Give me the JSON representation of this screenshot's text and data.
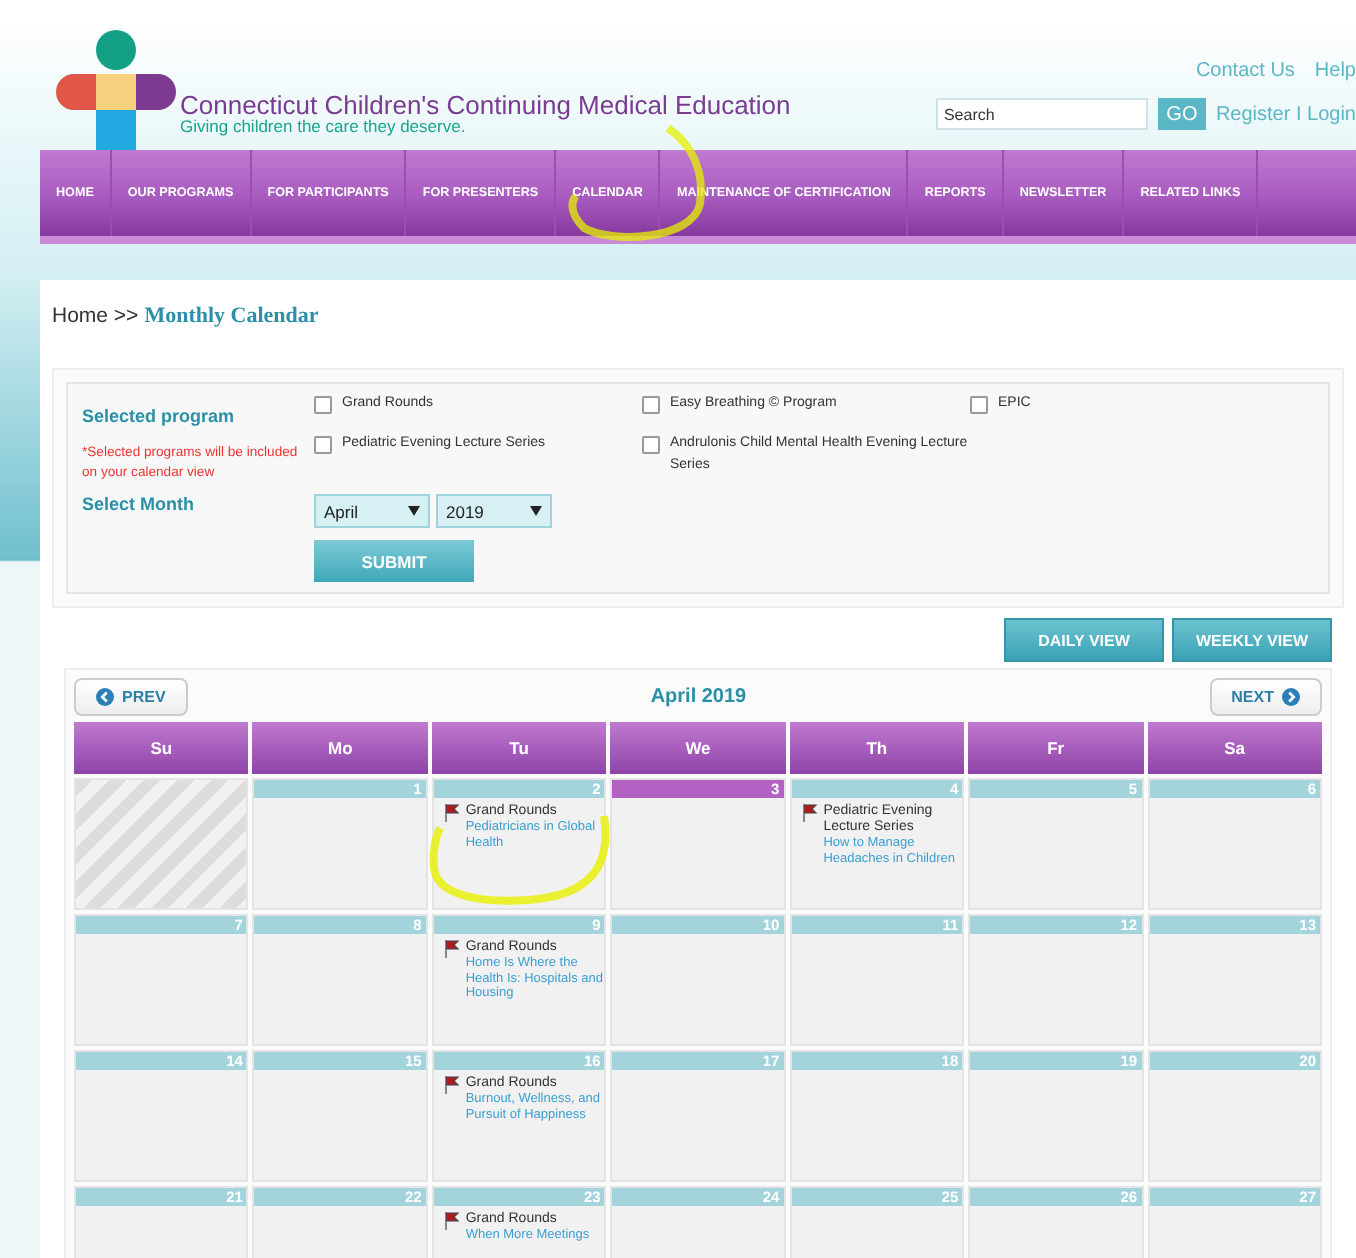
{
  "header": {
    "title": "Connecticut Children's Continuing Medical Education",
    "tagline": "Giving children the care they deserve.",
    "top_links": [
      "Contact Us",
      "Help"
    ],
    "search": {
      "placeholder": "Search",
      "button": "GO"
    },
    "account_links": "Register I Login"
  },
  "nav": [
    "HOME",
    "OUR PROGRAMS",
    "FOR PARTICIPANTS",
    "FOR PRESENTERS",
    "CALENDAR",
    "MAINTENANCE OF CERTIFICATION",
    "REPORTS",
    "NEWSLETTER",
    "RELATED LINKS"
  ],
  "breadcrumb": {
    "home": "Home >>",
    "current": "Monthly Calendar"
  },
  "filter": {
    "program_label": "Selected program",
    "note": "*Selected programs will be included on your calendar view",
    "programs": [
      {
        "label": "Grand Rounds",
        "checked": false
      },
      {
        "label": "Easy Breathing © Program",
        "checked": false
      },
      {
        "label": "EPIC",
        "checked": false
      },
      {
        "label": "Pediatric Evening Lecture Series",
        "checked": false
      },
      {
        "label": "Andrulonis Child Mental Health Evening Lecture Series",
        "checked": false
      }
    ],
    "month_label": "Select Month",
    "month": "April",
    "year": "2019",
    "submit": "SUBMIT"
  },
  "views": [
    "DAILY VIEW",
    "WEEKLY VIEW"
  ],
  "calendar": {
    "prev": "PREV",
    "title": "April 2019",
    "next": "NEXT",
    "days": [
      "Su",
      "Mo",
      "Tu",
      "We",
      "Th",
      "Fr",
      "Sa"
    ],
    "weeks": [
      [
        {
          "kind": "blank"
        },
        {
          "kind": "day",
          "date": "1",
          "today": false
        },
        {
          "kind": "day",
          "date": "2",
          "today": false,
          "events": [
            {
              "program": "Grand Rounds",
              "title": "Pediatricians in Global Health"
            }
          ]
        },
        {
          "kind": "day",
          "date": "3",
          "today": true
        },
        {
          "kind": "day",
          "date": "4",
          "today": false,
          "events": [
            {
              "program": "Pediatric Evening Lecture Series",
              "title": "How to Manage Headaches in Children"
            }
          ]
        },
        {
          "kind": "day",
          "date": "5",
          "today": false
        },
        {
          "kind": "day",
          "date": "6",
          "today": false
        }
      ],
      [
        {
          "kind": "day",
          "date": "7",
          "today": false
        },
        {
          "kind": "day",
          "date": "8",
          "today": false
        },
        {
          "kind": "day",
          "date": "9",
          "today": false,
          "events": [
            {
              "program": "Grand Rounds",
              "title": "Home Is Where the Health Is: Hospitals and Housing"
            }
          ]
        },
        {
          "kind": "day",
          "date": "10",
          "today": false
        },
        {
          "kind": "day",
          "date": "11",
          "today": false
        },
        {
          "kind": "day",
          "date": "12",
          "today": false
        },
        {
          "kind": "day",
          "date": "13",
          "today": false
        }
      ],
      [
        {
          "kind": "day",
          "date": "14",
          "today": false
        },
        {
          "kind": "day",
          "date": "15",
          "today": false
        },
        {
          "kind": "day",
          "date": "16",
          "today": false,
          "events": [
            {
              "program": "Grand Rounds",
              "title": "Burnout, Wellness, and Pursuit of Happiness"
            }
          ]
        },
        {
          "kind": "day",
          "date": "17",
          "today": false
        },
        {
          "kind": "day",
          "date": "18",
          "today": false
        },
        {
          "kind": "day",
          "date": "19",
          "today": false
        },
        {
          "kind": "day",
          "date": "20",
          "today": false
        }
      ],
      [
        {
          "kind": "day",
          "date": "21",
          "today": false
        },
        {
          "kind": "day",
          "date": "22",
          "today": false
        },
        {
          "kind": "day",
          "date": "23",
          "today": false,
          "events": [
            {
              "program": "Grand Rounds",
              "title": "When More Meetings"
            }
          ]
        },
        {
          "kind": "day",
          "date": "24",
          "today": false
        },
        {
          "kind": "day",
          "date": "25",
          "today": false
        },
        {
          "kind": "day",
          "date": "26",
          "today": false
        },
        {
          "kind": "day",
          "date": "27",
          "today": false
        }
      ]
    ]
  }
}
